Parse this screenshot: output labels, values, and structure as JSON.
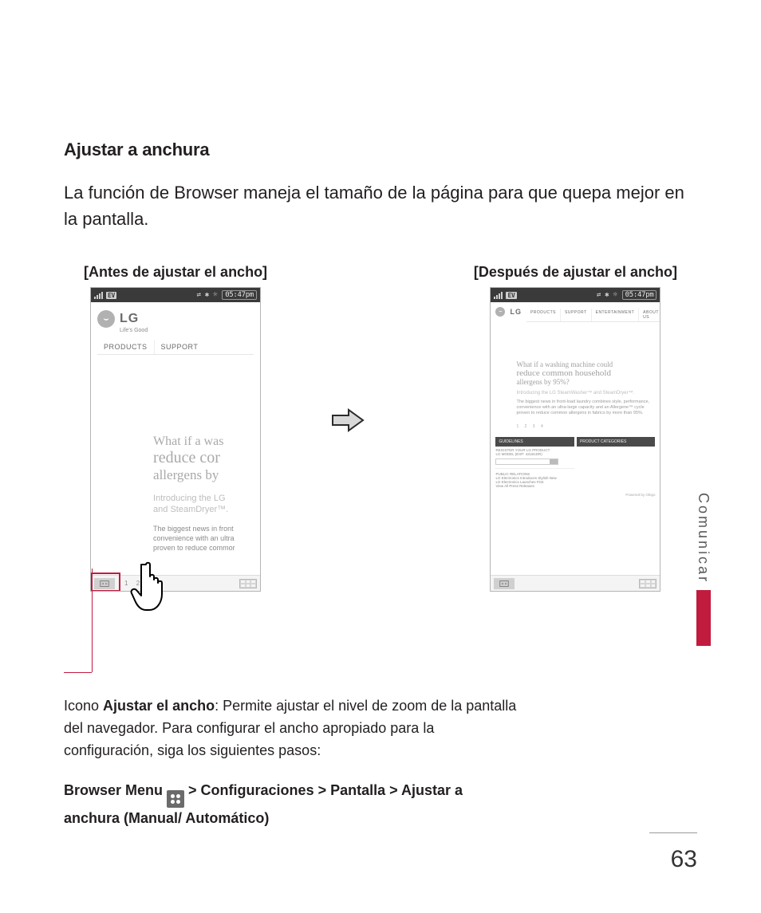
{
  "section": {
    "title": "Ajustar a anchura",
    "lead": "La función de Browser maneja el tamaño de la página para que quepa mejor en la pantalla."
  },
  "figures": {
    "before_caption": "[Antes de ajustar el ancho]",
    "after_caption": "[Después de ajustar el ancho]"
  },
  "phone": {
    "status": {
      "carrier_badge": "EV",
      "time": "05:47pm"
    },
    "logo_text": "LG",
    "logo_tag": "Life's Good",
    "tabs": {
      "products": "PRODUCTS",
      "support": "SUPPORT",
      "entertainment": "ENTERTAINMENT",
      "about": "ABOUT US"
    },
    "hero_before": {
      "l1": "What if a was",
      "l2": "reduce cor",
      "l3": "allergens by"
    },
    "intro_before": {
      "l1": "Introducing the LG",
      "l2": "and SteamDryer™."
    },
    "body_before": {
      "l1": "The biggest news in front",
      "l2": "convenience with an ultra",
      "l3": "proven to reduce commor"
    },
    "pager_before": "1  2  3  4",
    "hero_after": {
      "l1": "What if a washing machine could",
      "l2": "reduce common household",
      "l3": "allergens by 95%?"
    },
    "intro_after": "Introducing the LG SteamWasher™ and SteamDryer™.",
    "body_after": "The biggest news in front-load laundry combines style, performance, convenience with an ultra-large capacity and an Allergene™ cycle proven to reduce common allergens in fabrics by more than 95%.",
    "pager_after": "1 2 3 4",
    "bars": {
      "guidelines": "GUIDELINES",
      "categories": "PRODUCT CATEGORIES"
    },
    "list": {
      "reg_hdr": "REGISTER YOUR LG PRODUCT",
      "reg_sub": "LG MODEL (EXP: 42LB1DR)",
      "pub_hdr": "PUBLIC RELATIONS",
      "pub_sub1": "LG Electronics Introduces Stylish New",
      "pub_sub2": "LG Electronics Launches First",
      "more": "View All Press Releases"
    },
    "provider": "Powered by Obigo"
  },
  "callout": {
    "label": "Icono ",
    "title": "Ajustar el ancho",
    "text": ": Permite ajustar el nivel de zoom de la pantalla del navegador. Para configurar el ancho apropiado para la configuración, siga los siguientes pasos:"
  },
  "path": {
    "p1": "Browser Menu ",
    "p2": " > Configuraciones > Pantalla > Ajustar a anchura (Manual/ Automático)"
  },
  "sidetab": "Comunicar",
  "page_number": "63"
}
